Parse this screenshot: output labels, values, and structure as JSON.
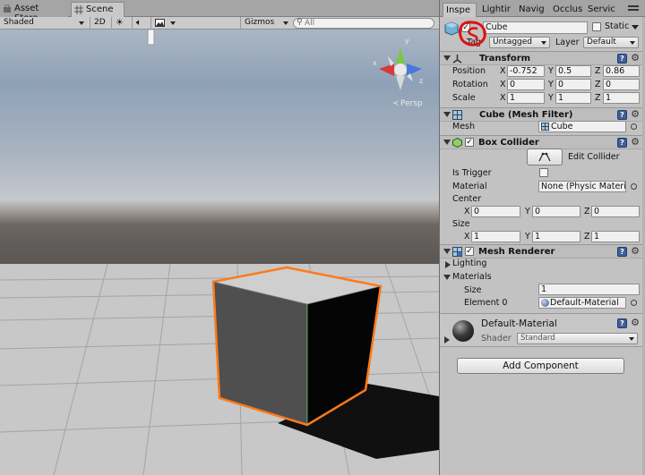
{
  "left_tabs": [
    {
      "label": "Asset Store",
      "icon": "shopping-bag-icon"
    },
    {
      "label": "Scene",
      "icon": "grid-icon"
    }
  ],
  "scene_toolbar": {
    "shading": "Shaded",
    "mode_2d": "2D",
    "lighting_icon": "sun-icon",
    "audio_icon": "speaker-icon",
    "effects_icon": "image-icon",
    "gizmos": "Gizmos",
    "search_placeholder": "All"
  },
  "scene": {
    "gizmo_axes": {
      "y": "y",
      "x": "x",
      "z": "z"
    },
    "projection": "Persp",
    "selected_object": "Cube",
    "outline_color": "#ff7a1a"
  },
  "right_tabs": [
    "Inspe",
    "Lightir",
    "Navig",
    "Occlus",
    "Servic"
  ],
  "inspector": {
    "object": {
      "active": true,
      "name": "Cube",
      "static_label": "Static",
      "tag_label": "Tag",
      "tag_value": "Untagged",
      "layer_label": "Layer",
      "layer_value": "Default"
    },
    "transform": {
      "title": "Transform",
      "position_label": "Position",
      "rotation_label": "Rotation",
      "scale_label": "Scale",
      "axis_x": "X",
      "axis_y": "Y",
      "axis_z": "Z",
      "position": [
        "-0.752",
        "0.5",
        "0.86"
      ],
      "rotation": [
        "0",
        "0",
        "0"
      ],
      "scale": [
        "1",
        "1",
        "1"
      ]
    },
    "mesh_filter": {
      "title": "Cube (Mesh Filter)",
      "mesh_label": "Mesh",
      "mesh_value": "Cube"
    },
    "box_collider": {
      "title": "Box Collider",
      "enabled": true,
      "edit_collider": "Edit Collider",
      "is_trigger_label": "Is Trigger",
      "is_trigger": false,
      "material_label": "Material",
      "material_value": "None (Physic Materi",
      "center_label": "Center",
      "size_label": "Size",
      "center": [
        "0",
        "0",
        "0"
      ],
      "size": [
        "1",
        "1",
        "1"
      ]
    },
    "mesh_renderer": {
      "title": "Mesh Renderer",
      "enabled": true,
      "lighting_label": "Lighting",
      "materials_label": "Materials",
      "size_label": "Size",
      "size_value": "1",
      "element0_label": "Element 0",
      "element0_value": "Default-Material"
    },
    "material": {
      "name": "Default-Material",
      "shader_label": "Shader",
      "shader_value": "Standard"
    },
    "add_component": "Add Component"
  },
  "annotation_color": "#e01010"
}
